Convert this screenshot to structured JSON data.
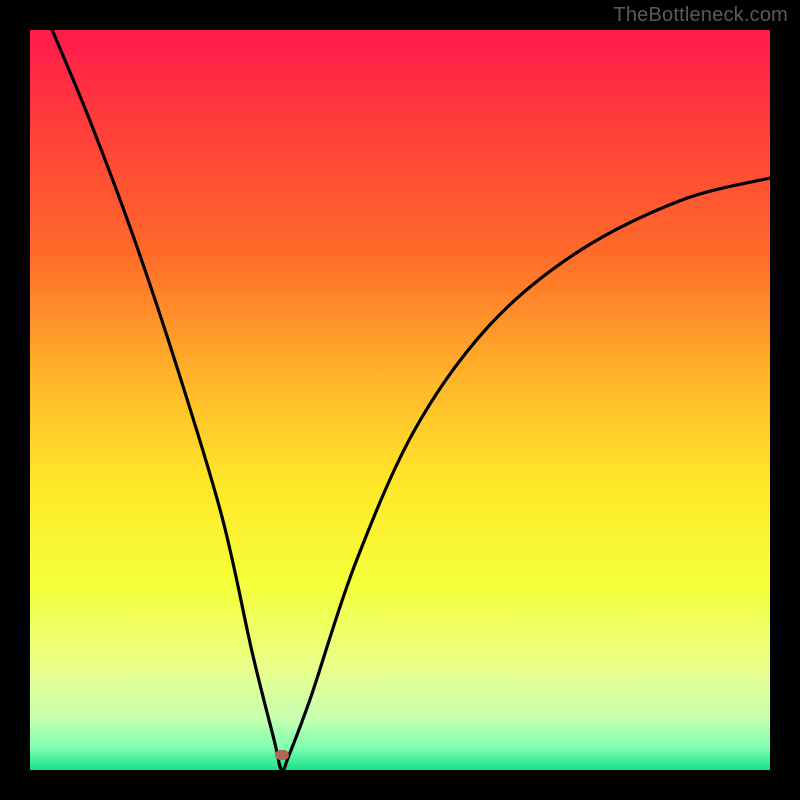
{
  "watermark": "TheBottleneck.com",
  "colors": {
    "page_bg": "#000000",
    "curve_stroke": "#000000",
    "marker_fill": "#b5645c",
    "gradient_top": "#ff1a4d",
    "gradient_bottom": "#18e28a"
  },
  "chart_data": {
    "type": "line",
    "title": "",
    "xlabel": "",
    "ylabel": "",
    "xlim": [
      0,
      100
    ],
    "ylim": [
      0,
      100
    ],
    "grid": false,
    "note": "Stylized bottleneck V-curve over a red-to-green gradient. Axes have no tick labels; values are pixel-proportional estimates from the image.",
    "minimum": {
      "x": 34,
      "y": 0
    },
    "marker": {
      "x": 34,
      "y": 2
    },
    "series": [
      {
        "name": "bottleneck-curve",
        "points": [
          {
            "x": 3,
            "y": 100
          },
          {
            "x": 8,
            "y": 88
          },
          {
            "x": 14,
            "y": 72
          },
          {
            "x": 20,
            "y": 54
          },
          {
            "x": 26,
            "y": 34
          },
          {
            "x": 30,
            "y": 16
          },
          {
            "x": 33,
            "y": 4
          },
          {
            "x": 34,
            "y": 0
          },
          {
            "x": 35,
            "y": 2
          },
          {
            "x": 38,
            "y": 10
          },
          {
            "x": 44,
            "y": 28
          },
          {
            "x": 52,
            "y": 46
          },
          {
            "x": 62,
            "y": 60
          },
          {
            "x": 74,
            "y": 70
          },
          {
            "x": 88,
            "y": 77
          },
          {
            "x": 100,
            "y": 80
          }
        ]
      }
    ]
  }
}
